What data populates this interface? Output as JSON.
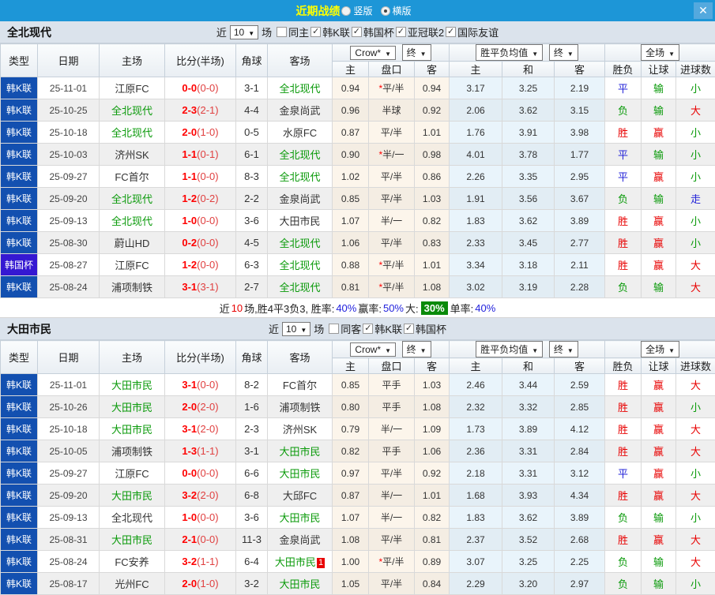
{
  "topbar": {
    "title": "近期战绩",
    "radio_vertical": "竖版",
    "radio_horizontal": "横版",
    "selected": "横版",
    "close": "✕"
  },
  "colors": {
    "topbar_bg": "#1d96d7",
    "title": "#ffff00",
    "team_highlight": "#0a9a0a",
    "score_red": "#ff0000"
  },
  "value_colors": {
    "胜": "#e80000",
    "平": "#2424d8",
    "负": "#0a9a0a",
    "赢": "#e80000",
    "输": "#0a9a0a",
    "大": "#e80000",
    "小": "#0a9a0a",
    "走": "#2424d8"
  },
  "type_colors": {
    "韩K联": "#1350b0",
    "韩国杯": "#3518d2"
  },
  "table_header": {
    "type": "类型",
    "date": "日期",
    "home": "主场",
    "score": "比分(半场)",
    "corner": "角球",
    "away": "客场",
    "odds_home": "主",
    "odds_hcp": "盘口",
    "odds_away": "客",
    "avg_home": "主",
    "avg_draw": "和",
    "avg_away": "客",
    "outcome": "胜负",
    "hcp_result": "让球",
    "goals": "进球数",
    "dd_odds_src": "Crow*",
    "dd_odds_stage": "终",
    "dd_avg": "胜平负均值",
    "dd_avg_stage": "终",
    "dd_scope": "全场"
  },
  "tables": [
    {
      "team": "全北现代",
      "filters": {
        "near": "近",
        "count": "10",
        "suffix": "场",
        "same": {
          "label": "同主",
          "checked": false
        },
        "leagues": [
          {
            "label": "韩K联",
            "checked": true
          },
          {
            "label": "韩国杯",
            "checked": true
          },
          {
            "label": "亚冠联2",
            "checked": true
          },
          {
            "label": "国际友谊",
            "checked": true
          }
        ]
      },
      "rows": [
        {
          "type": "韩K联",
          "date": "25-11-01",
          "home": "江原FC",
          "home_hl": false,
          "score": "0-0",
          "half": "(0-0)",
          "corner": "3-1",
          "away": "全北现代",
          "away_hl": true,
          "card": "",
          "crow": [
            "0.94",
            "*平/半",
            "0.94"
          ],
          "avg": [
            "3.17",
            "3.25",
            "2.19"
          ],
          "res": [
            "平",
            "输",
            "小"
          ]
        },
        {
          "type": "韩K联",
          "date": "25-10-25",
          "home": "全北现代",
          "home_hl": true,
          "score": "2-3",
          "half": "(2-1)",
          "corner": "4-4",
          "away": "金泉尚武",
          "away_hl": false,
          "card": "",
          "crow": [
            "0.96",
            "半球",
            "0.92"
          ],
          "avg": [
            "2.06",
            "3.62",
            "3.15"
          ],
          "res": [
            "负",
            "输",
            "大"
          ]
        },
        {
          "type": "韩K联",
          "date": "25-10-18",
          "home": "全北现代",
          "home_hl": true,
          "score": "2-0",
          "half": "(1-0)",
          "corner": "0-5",
          "away": "水原FC",
          "away_hl": false,
          "card": "",
          "crow": [
            "0.87",
            "平/半",
            "1.01"
          ],
          "avg": [
            "1.76",
            "3.91",
            "3.98"
          ],
          "res": [
            "胜",
            "赢",
            "小"
          ]
        },
        {
          "type": "韩K联",
          "date": "25-10-03",
          "home": "济州SK",
          "home_hl": false,
          "score": "1-1",
          "half": "(0-1)",
          "corner": "6-1",
          "away": "全北现代",
          "away_hl": true,
          "card": "",
          "crow": [
            "0.90",
            "*半/一",
            "0.98"
          ],
          "avg": [
            "4.01",
            "3.78",
            "1.77"
          ],
          "res": [
            "平",
            "输",
            "小"
          ]
        },
        {
          "type": "韩K联",
          "date": "25-09-27",
          "home": "FC首尔",
          "home_hl": false,
          "score": "1-1",
          "half": "(0-0)",
          "corner": "8-3",
          "away": "全北现代",
          "away_hl": true,
          "card": "",
          "crow": [
            "1.02",
            "平/半",
            "0.86"
          ],
          "avg": [
            "2.26",
            "3.35",
            "2.95"
          ],
          "res": [
            "平",
            "赢",
            "小"
          ]
        },
        {
          "type": "韩K联",
          "date": "25-09-20",
          "home": "全北现代",
          "home_hl": true,
          "score": "1-2",
          "half": "(0-2)",
          "corner": "2-2",
          "away": "金泉尚武",
          "away_hl": false,
          "card": "",
          "crow": [
            "0.85",
            "平/半",
            "1.03"
          ],
          "avg": [
            "1.91",
            "3.56",
            "3.67"
          ],
          "res": [
            "负",
            "输",
            "走"
          ]
        },
        {
          "type": "韩K联",
          "date": "25-09-13",
          "home": "全北现代",
          "home_hl": true,
          "score": "1-0",
          "half": "(0-0)",
          "corner": "3-6",
          "away": "大田市民",
          "away_hl": false,
          "card": "",
          "crow": [
            "1.07",
            "半/一",
            "0.82"
          ],
          "avg": [
            "1.83",
            "3.62",
            "3.89"
          ],
          "res": [
            "胜",
            "赢",
            "小"
          ]
        },
        {
          "type": "韩K联",
          "date": "25-08-30",
          "home": "蔚山HD",
          "home_hl": false,
          "score": "0-2",
          "half": "(0-0)",
          "corner": "4-5",
          "away": "全北现代",
          "away_hl": true,
          "card": "",
          "crow": [
            "1.06",
            "平/半",
            "0.83"
          ],
          "avg": [
            "2.33",
            "3.45",
            "2.77"
          ],
          "res": [
            "胜",
            "赢",
            "小"
          ]
        },
        {
          "type": "韩国杯",
          "date": "25-08-27",
          "home": "江原FC",
          "home_hl": false,
          "score": "1-2",
          "half": "(0-0)",
          "corner": "6-3",
          "away": "全北现代",
          "away_hl": true,
          "card": "",
          "crow": [
            "0.88",
            "*平/半",
            "1.01"
          ],
          "avg": [
            "3.34",
            "3.18",
            "2.11"
          ],
          "res": [
            "胜",
            "赢",
            "大"
          ]
        },
        {
          "type": "韩K联",
          "date": "25-08-24",
          "home": "浦项制铁",
          "home_hl": false,
          "score": "3-1",
          "half": "(3-1)",
          "corner": "2-7",
          "away": "全北现代",
          "away_hl": true,
          "card": "",
          "crow": [
            "0.81",
            "*平/半",
            "1.08"
          ],
          "avg": [
            "3.02",
            "3.19",
            "2.28"
          ],
          "res": [
            "负",
            "输",
            "大"
          ]
        }
      ],
      "summary": {
        "seg1": "近",
        "count": "10",
        "seg2": "场,胜4平3负3, 胜率:",
        "win_rate": "40%",
        "seg3": " 赢率:",
        "profit_rate": "50%",
        "seg4": " 大:",
        "big_rate": "30%",
        "seg5": " 单率:",
        "single_rate": "40%"
      }
    },
    {
      "team": "大田市民",
      "filters": {
        "near": "近",
        "count": "10",
        "suffix": "场",
        "same": {
          "label": "同客",
          "checked": false
        },
        "leagues": [
          {
            "label": "韩K联",
            "checked": true
          },
          {
            "label": "韩国杯",
            "checked": true
          }
        ]
      },
      "rows": [
        {
          "type": "韩K联",
          "date": "25-11-01",
          "home": "大田市民",
          "home_hl": true,
          "score": "3-1",
          "half": "(0-0)",
          "corner": "8-2",
          "away": "FC首尔",
          "away_hl": false,
          "card": "",
          "crow": [
            "0.85",
            "平手",
            "1.03"
          ],
          "avg": [
            "2.46",
            "3.44",
            "2.59"
          ],
          "res": [
            "胜",
            "赢",
            "大"
          ]
        },
        {
          "type": "韩K联",
          "date": "25-10-26",
          "home": "大田市民",
          "home_hl": true,
          "score": "2-0",
          "half": "(2-0)",
          "corner": "1-6",
          "away": "浦项制铁",
          "away_hl": false,
          "card": "",
          "crow": [
            "0.80",
            "平手",
            "1.08"
          ],
          "avg": [
            "2.32",
            "3.32",
            "2.85"
          ],
          "res": [
            "胜",
            "赢",
            "小"
          ]
        },
        {
          "type": "韩K联",
          "date": "25-10-18",
          "home": "大田市民",
          "home_hl": true,
          "score": "3-1",
          "half": "(2-0)",
          "corner": "2-3",
          "away": "济州SK",
          "away_hl": false,
          "card": "",
          "crow": [
            "0.79",
            "半/一",
            "1.09"
          ],
          "avg": [
            "1.73",
            "3.89",
            "4.12"
          ],
          "res": [
            "胜",
            "赢",
            "大"
          ]
        },
        {
          "type": "韩K联",
          "date": "25-10-05",
          "home": "浦项制铁",
          "home_hl": false,
          "score": "1-3",
          "half": "(1-1)",
          "corner": "3-1",
          "away": "大田市民",
          "away_hl": true,
          "card": "",
          "crow": [
            "0.82",
            "平手",
            "1.06"
          ],
          "avg": [
            "2.36",
            "3.31",
            "2.84"
          ],
          "res": [
            "胜",
            "赢",
            "大"
          ]
        },
        {
          "type": "韩K联",
          "date": "25-09-27",
          "home": "江原FC",
          "home_hl": false,
          "score": "0-0",
          "half": "(0-0)",
          "corner": "6-6",
          "away": "大田市民",
          "away_hl": true,
          "card": "",
          "crow": [
            "0.97",
            "平/半",
            "0.92"
          ],
          "avg": [
            "2.18",
            "3.31",
            "3.12"
          ],
          "res": [
            "平",
            "赢",
            "小"
          ]
        },
        {
          "type": "韩K联",
          "date": "25-09-20",
          "home": "大田市民",
          "home_hl": true,
          "score": "3-2",
          "half": "(2-0)",
          "corner": "6-8",
          "away": "大邱FC",
          "away_hl": false,
          "card": "",
          "crow": [
            "0.87",
            "半/一",
            "1.01"
          ],
          "avg": [
            "1.68",
            "3.93",
            "4.34"
          ],
          "res": [
            "胜",
            "赢",
            "大"
          ]
        },
        {
          "type": "韩K联",
          "date": "25-09-13",
          "home": "全北现代",
          "home_hl": false,
          "score": "1-0",
          "half": "(0-0)",
          "corner": "3-6",
          "away": "大田市民",
          "away_hl": true,
          "card": "",
          "crow": [
            "1.07",
            "半/一",
            "0.82"
          ],
          "avg": [
            "1.83",
            "3.62",
            "3.89"
          ],
          "res": [
            "负",
            "输",
            "小"
          ]
        },
        {
          "type": "韩K联",
          "date": "25-08-31",
          "home": "大田市民",
          "home_hl": true,
          "score": "2-1",
          "half": "(0-0)",
          "corner": "11-3",
          "away": "金泉尚武",
          "away_hl": false,
          "card": "",
          "crow": [
            "1.08",
            "平/半",
            "0.81"
          ],
          "avg": [
            "2.37",
            "3.52",
            "2.68"
          ],
          "res": [
            "胜",
            "赢",
            "大"
          ]
        },
        {
          "type": "韩K联",
          "date": "25-08-24",
          "home": "FC安养",
          "home_hl": false,
          "score": "3-2",
          "half": "(1-1)",
          "corner": "6-4",
          "away": "大田市民",
          "away_hl": true,
          "card": "1",
          "crow": [
            "1.00",
            "*平/半",
            "0.89"
          ],
          "avg": [
            "3.07",
            "3.25",
            "2.25"
          ],
          "res": [
            "负",
            "输",
            "大"
          ]
        },
        {
          "type": "韩K联",
          "date": "25-08-17",
          "home": "光州FC",
          "home_hl": false,
          "score": "2-0",
          "half": "(1-0)",
          "corner": "3-2",
          "away": "大田市民",
          "away_hl": true,
          "card": "",
          "crow": [
            "1.05",
            "平/半",
            "0.84"
          ],
          "avg": [
            "2.29",
            "3.20",
            "2.97"
          ],
          "res": [
            "负",
            "输",
            "小"
          ]
        }
      ]
    }
  ]
}
